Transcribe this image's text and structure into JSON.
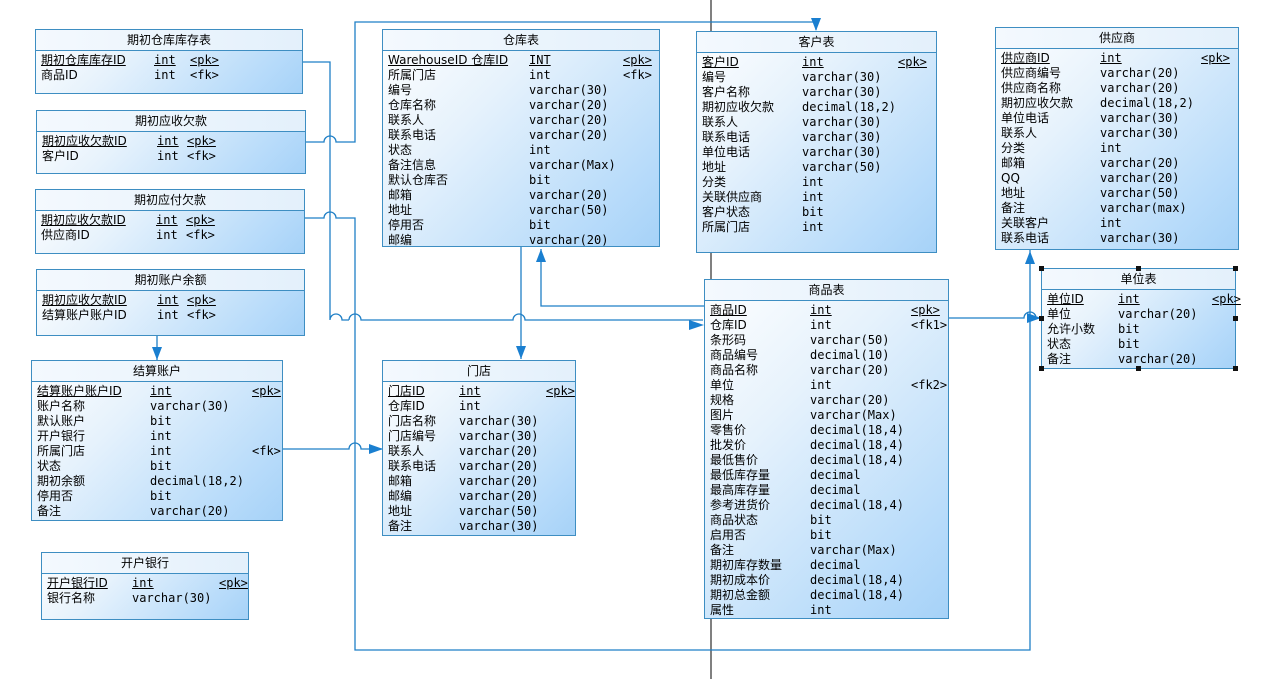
{
  "diagram_title": "",
  "entities": {
    "init_stock": {
      "title": "期初仓库库存表",
      "columns": [
        {
          "name": "期初仓库库存ID",
          "type": "int",
          "key": "<pk>",
          "pk": true
        },
        {
          "name": "商品ID",
          "type": "int",
          "key": "<fk>",
          "pk": false
        }
      ]
    },
    "init_receivable": {
      "title": "期初应收欠款",
      "columns": [
        {
          "name": "期初应收欠款ID",
          "type": "int",
          "key": "<pk>",
          "pk": true
        },
        {
          "name": "客户ID",
          "type": "int",
          "key": "<fk>",
          "pk": false
        }
      ]
    },
    "init_payable": {
      "title": "期初应付欠款",
      "columns": [
        {
          "name": "期初应收欠款ID",
          "type": "int",
          "key": "<pk>",
          "pk": true
        },
        {
          "name": "供应商ID",
          "type": "int",
          "key": "<fk>",
          "pk": false
        }
      ]
    },
    "init_balance": {
      "title": "期初账户余额",
      "columns": [
        {
          "name": "期初应收欠款ID",
          "type": "int",
          "key": "<pk>",
          "pk": true
        },
        {
          "name": "结算账户账户ID",
          "type": "int",
          "key": "<fk>",
          "pk": false
        }
      ]
    },
    "settle_account": {
      "title": "结算账户",
      "columns": [
        {
          "name": "结算账户账户ID",
          "type": "int",
          "key": "<pk>",
          "pk": true
        },
        {
          "name": "账户名称",
          "type": "varchar(30)",
          "key": "",
          "pk": false
        },
        {
          "name": "默认账户",
          "type": "bit",
          "key": "",
          "pk": false
        },
        {
          "name": "开户银行",
          "type": "int",
          "key": "",
          "pk": false
        },
        {
          "name": "所属门店",
          "type": "int",
          "key": "<fk>",
          "pk": false
        },
        {
          "name": "状态",
          "type": "bit",
          "key": "",
          "pk": false
        },
        {
          "name": "期初余额",
          "type": "decimal(18,2)",
          "key": "",
          "pk": false
        },
        {
          "name": "停用否",
          "type": "bit",
          "key": "",
          "pk": false
        },
        {
          "name": "备注",
          "type": "varchar(20)",
          "key": "",
          "pk": false
        }
      ]
    },
    "bank": {
      "title": "开户银行",
      "columns": [
        {
          "name": "开户银行ID",
          "type": "int",
          "key": "<pk>",
          "pk": true
        },
        {
          "name": "银行名称",
          "type": "varchar(30)",
          "key": "",
          "pk": false
        }
      ]
    },
    "warehouse": {
      "title": "仓库表",
      "columns": [
        {
          "name": "WarehouseID 仓库ID",
          "type": "INT",
          "key": "<pk>",
          "pk": true
        },
        {
          "name": "所属门店",
          "type": "int",
          "key": "<fk>",
          "pk": false
        },
        {
          "name": "编号",
          "type": "varchar(30)",
          "key": "",
          "pk": false
        },
        {
          "name": "仓库名称",
          "type": "varchar(20)",
          "key": "",
          "pk": false
        },
        {
          "name": "联系人",
          "type": "varchar(20)",
          "key": "",
          "pk": false
        },
        {
          "name": "联系电话",
          "type": "varchar(20)",
          "key": "",
          "pk": false
        },
        {
          "name": "状态",
          "type": "int",
          "key": "",
          "pk": false
        },
        {
          "name": "备注信息",
          "type": "varchar(Max)",
          "key": "",
          "pk": false
        },
        {
          "name": "默认仓库否",
          "type": "bit",
          "key": "",
          "pk": false
        },
        {
          "name": "邮箱",
          "type": "varchar(20)",
          "key": "",
          "pk": false
        },
        {
          "name": "地址",
          "type": "varchar(50)",
          "key": "",
          "pk": false
        },
        {
          "name": "停用否",
          "type": "bit",
          "key": "",
          "pk": false
        },
        {
          "name": "邮编",
          "type": "varchar(20)",
          "key": "",
          "pk": false
        }
      ]
    },
    "store": {
      "title": "门店",
      "columns": [
        {
          "name": "门店ID",
          "type": "int",
          "key": "<pk>",
          "pk": true
        },
        {
          "name": "仓库ID",
          "type": "int",
          "key": "",
          "pk": false
        },
        {
          "name": "门店名称",
          "type": "varchar(30)",
          "key": "",
          "pk": false
        },
        {
          "name": "门店编号",
          "type": "varchar(30)",
          "key": "",
          "pk": false
        },
        {
          "name": "联系人",
          "type": "varchar(20)",
          "key": "",
          "pk": false
        },
        {
          "name": "联系电话",
          "type": "varchar(20)",
          "key": "",
          "pk": false
        },
        {
          "name": "邮箱",
          "type": "varchar(20)",
          "key": "",
          "pk": false
        },
        {
          "name": "邮编",
          "type": "varchar(20)",
          "key": "",
          "pk": false
        },
        {
          "name": "地址",
          "type": "varchar(50)",
          "key": "",
          "pk": false
        },
        {
          "name": "备注",
          "type": "varchar(30)",
          "key": "",
          "pk": false
        }
      ]
    },
    "customer": {
      "title": "客户表",
      "columns": [
        {
          "name": "客户ID",
          "type": "int",
          "key": "<pk>",
          "pk": true
        },
        {
          "name": "编号",
          "type": "varchar(30)",
          "key": "",
          "pk": false
        },
        {
          "name": "客户名称",
          "type": "varchar(30)",
          "key": "",
          "pk": false
        },
        {
          "name": "期初应收欠款",
          "type": "decimal(18,2)",
          "key": "",
          "pk": false
        },
        {
          "name": "联系人",
          "type": "varchar(30)",
          "key": "",
          "pk": false
        },
        {
          "name": "联系电话",
          "type": "varchar(30)",
          "key": "",
          "pk": false
        },
        {
          "name": "单位电话",
          "type": "varchar(30)",
          "key": "",
          "pk": false
        },
        {
          "name": "地址",
          "type": "varchar(50)",
          "key": "",
          "pk": false
        },
        {
          "name": "分类",
          "type": "int",
          "key": "",
          "pk": false
        },
        {
          "name": "关联供应商",
          "type": "int",
          "key": "",
          "pk": false
        },
        {
          "name": "客户状态",
          "type": "bit",
          "key": "",
          "pk": false
        },
        {
          "name": "所属门店",
          "type": "int",
          "key": "",
          "pk": false
        }
      ]
    },
    "product": {
      "title": "商品表",
      "columns": [
        {
          "name": "商品ID",
          "type": "int",
          "key": "<pk>",
          "pk": true
        },
        {
          "name": "仓库ID",
          "type": "int",
          "key": "<fk1>",
          "pk": false
        },
        {
          "name": "条形码",
          "type": "varchar(50)",
          "key": "",
          "pk": false
        },
        {
          "name": "商品编号",
          "type": "decimal(10)",
          "key": "",
          "pk": false
        },
        {
          "name": "商品名称",
          "type": "varchar(20)",
          "key": "",
          "pk": false
        },
        {
          "name": "单位",
          "type": "int",
          "key": "<fk2>",
          "pk": false
        },
        {
          "name": "规格",
          "type": "varchar(20)",
          "key": "",
          "pk": false
        },
        {
          "name": "图片",
          "type": "varchar(Max)",
          "key": "",
          "pk": false
        },
        {
          "name": "零售价",
          "type": "decimal(18,4)",
          "key": "",
          "pk": false
        },
        {
          "name": "批发价",
          "type": "decimal(18,4)",
          "key": "",
          "pk": false
        },
        {
          "name": "最低售价",
          "type": "decimal(18,4)",
          "key": "",
          "pk": false
        },
        {
          "name": "最低库存量",
          "type": "decimal",
          "key": "",
          "pk": false
        },
        {
          "name": "最高库存量",
          "type": "decimal",
          "key": "",
          "pk": false
        },
        {
          "name": "参考进货价",
          "type": "decimal(18,4)",
          "key": "",
          "pk": false
        },
        {
          "name": "商品状态",
          "type": "bit",
          "key": "",
          "pk": false
        },
        {
          "name": "启用否",
          "type": "bit",
          "key": "",
          "pk": false
        },
        {
          "name": "备注",
          "type": "varchar(Max)",
          "key": "",
          "pk": false
        },
        {
          "name": "期初库存数量",
          "type": "decimal",
          "key": "",
          "pk": false
        },
        {
          "name": "期初成本价",
          "type": "decimal(18,4)",
          "key": "",
          "pk": false
        },
        {
          "name": "期初总金额",
          "type": "decimal(18,4)",
          "key": "",
          "pk": false
        },
        {
          "name": "属性",
          "type": "int",
          "key": "",
          "pk": false
        }
      ]
    },
    "supplier": {
      "title": "供应商",
      "columns": [
        {
          "name": "供应商ID",
          "type": "int",
          "key": "<pk>",
          "pk": true
        },
        {
          "name": "供应商编号",
          "type": "varchar(20)",
          "key": "",
          "pk": false
        },
        {
          "name": "供应商名称",
          "type": "varchar(20)",
          "key": "",
          "pk": false
        },
        {
          "name": "期初应收欠款",
          "type": "decimal(18,2)",
          "key": "",
          "pk": false
        },
        {
          "name": "单位电话",
          "type": "varchar(30)",
          "key": "",
          "pk": false
        },
        {
          "name": "联系人",
          "type": "varchar(30)",
          "key": "",
          "pk": false
        },
        {
          "name": "分类",
          "type": "int",
          "key": "",
          "pk": false
        },
        {
          "name": "邮箱",
          "type": "varchar(20)",
          "key": "",
          "pk": false
        },
        {
          "name": "QQ",
          "type": "varchar(20)",
          "key": "",
          "pk": false
        },
        {
          "name": "地址",
          "type": "varchar(50)",
          "key": "",
          "pk": false
        },
        {
          "name": "备注",
          "type": "varchar(max)",
          "key": "",
          "pk": false
        },
        {
          "name": "关联客户",
          "type": "int",
          "key": "",
          "pk": false
        },
        {
          "name": "联系电话",
          "type": "varchar(30)",
          "key": "",
          "pk": false
        }
      ]
    },
    "unit": {
      "title": "单位表",
      "selected": true,
      "columns": [
        {
          "name": "单位ID",
          "type": "int",
          "key": "<pk>",
          "pk": true
        },
        {
          "name": "单位",
          "type": "varchar(20)",
          "key": "",
          "pk": false
        },
        {
          "name": "允许小数",
          "type": "bit",
          "key": "",
          "pk": false
        },
        {
          "name": "状态",
          "type": "bit",
          "key": "",
          "pk": false
        },
        {
          "name": "备注",
          "type": "varchar(20)",
          "key": "",
          "pk": false
        }
      ]
    }
  },
  "relationships": [
    {
      "from": "init_stock",
      "to": "product"
    },
    {
      "from": "init_receivable",
      "to": "customer"
    },
    {
      "from": "init_payable",
      "to": "supplier"
    },
    {
      "from": "init_balance",
      "to": "settle_account"
    },
    {
      "from": "settle_account",
      "to": "store"
    },
    {
      "from": "warehouse",
      "to": "store"
    },
    {
      "from": "product",
      "to": "warehouse"
    },
    {
      "from": "product",
      "to": "unit"
    }
  ],
  "colors": {
    "line": "#1f7fc6",
    "border": "#3e8ec2",
    "arrow": "#1a7fd0",
    "fill_light": "#ffffff",
    "fill_dark": "#a6d2f8"
  }
}
